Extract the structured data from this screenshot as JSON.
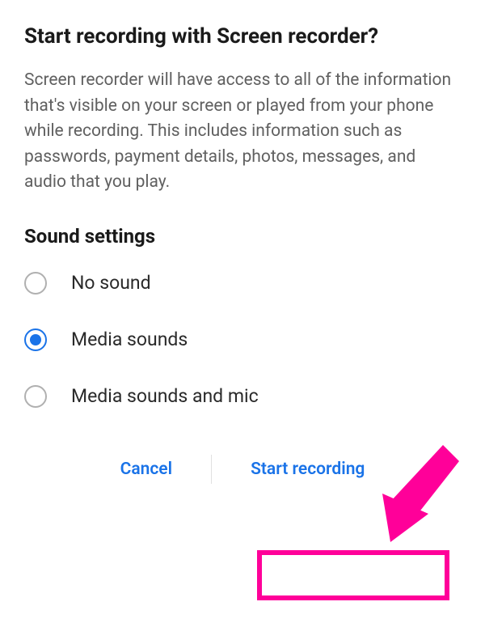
{
  "dialog": {
    "title": "Start recording with Screen recorder?",
    "description": "Screen recorder will have access to all of the information that's visible on your screen or played from your phone while recording. This includes information such as passwords, payment details, photos, messages, and audio that you play."
  },
  "sound_settings": {
    "section_title": "Sound settings",
    "options": [
      {
        "label": "No sound",
        "selected": false
      },
      {
        "label": "Media sounds",
        "selected": true
      },
      {
        "label": "Media sounds and mic",
        "selected": false
      }
    ]
  },
  "buttons": {
    "cancel": "Cancel",
    "confirm": "Start recording"
  },
  "colors": {
    "accent": "#1a73e8",
    "annotation": "#ff0099"
  }
}
